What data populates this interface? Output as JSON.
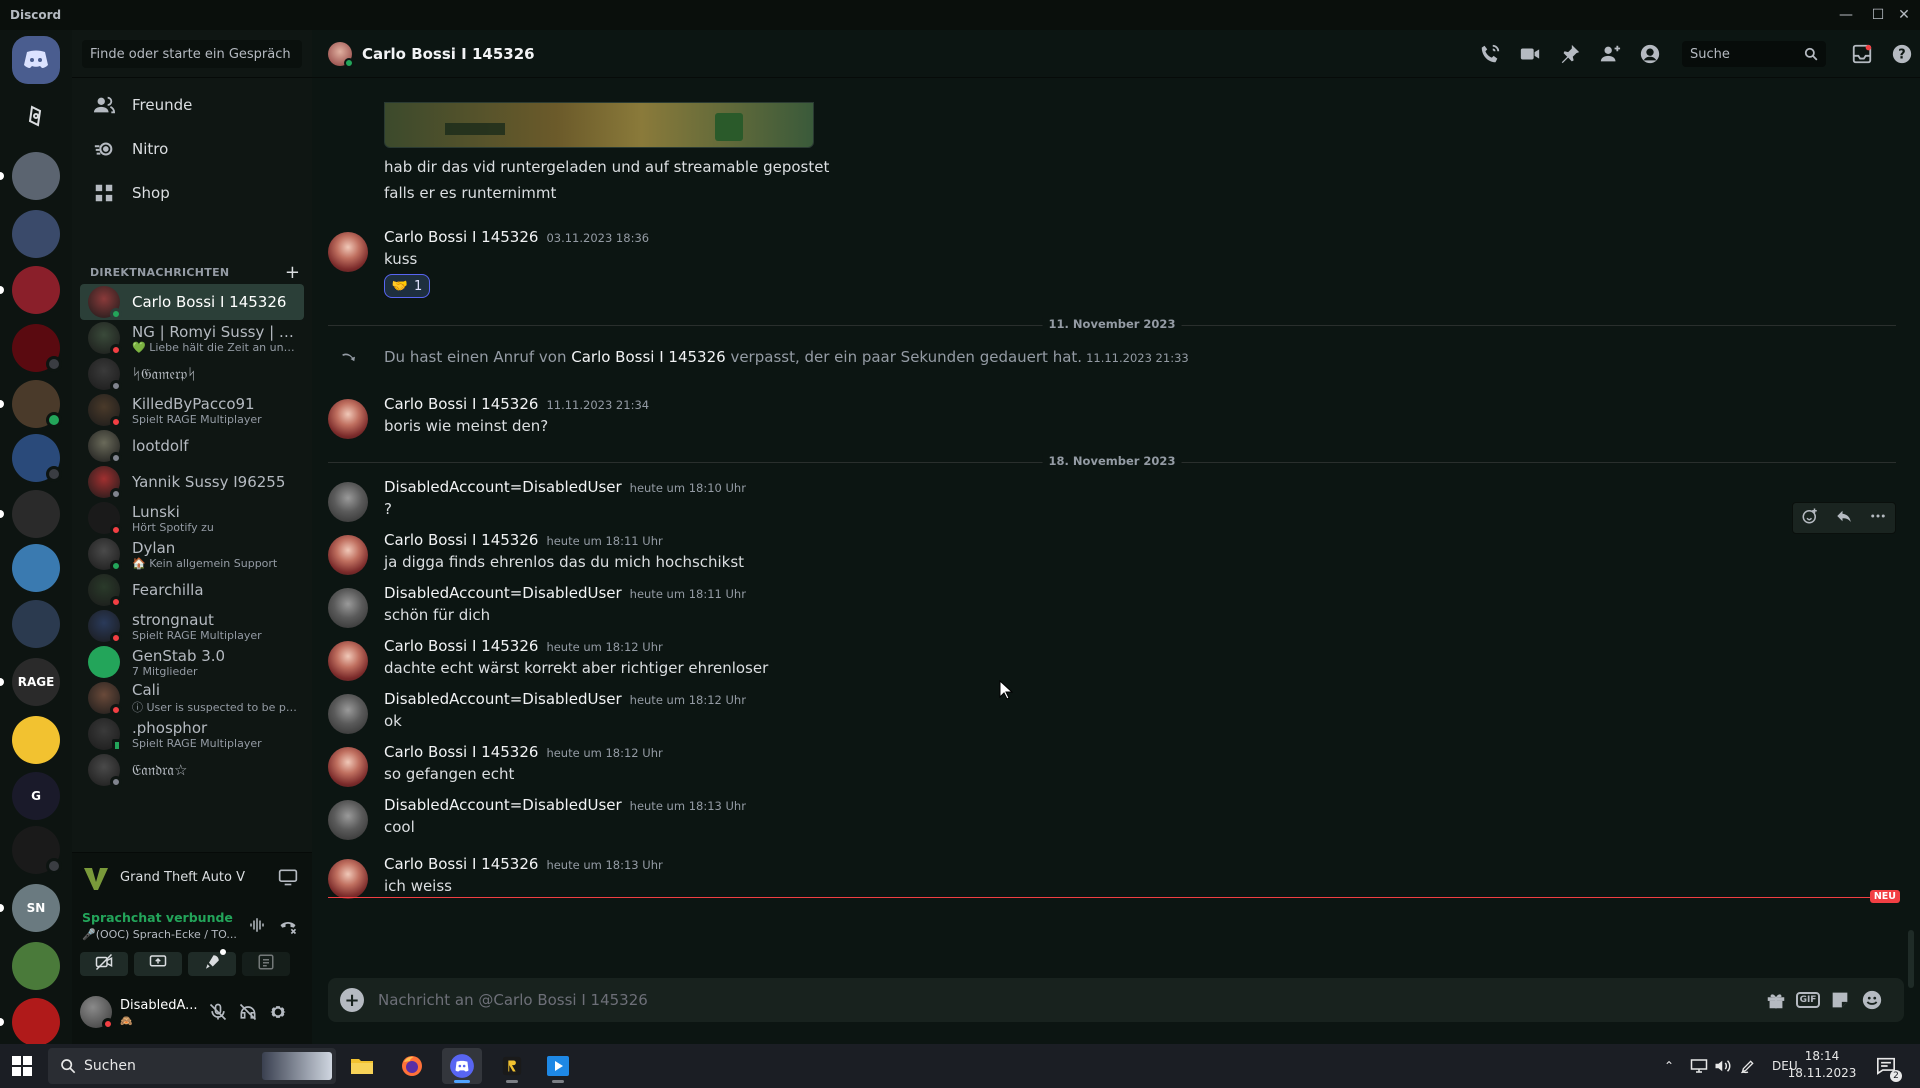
{
  "window": {
    "app_name": "Discord",
    "controls": {
      "minimize": "—",
      "maximize": "☐",
      "close": "✕"
    }
  },
  "servers": [
    {
      "icon": "discord-home-icon",
      "color": "#4a5d8f",
      "label": ""
    },
    {
      "icon": "shortcut-icon",
      "color": "#0d1411",
      "label": ""
    },
    {
      "icon": "server-moon-icon",
      "color": "#5b6470",
      "label": ""
    },
    {
      "icon": "server-crest-icon",
      "color": "#3a4a6a",
      "label": ""
    },
    {
      "icon": "server-red-icon",
      "color": "#8a1f2a",
      "label": ""
    },
    {
      "icon": "server-red-orb-icon",
      "color": "#5a0a10",
      "label": ""
    },
    {
      "icon": "server-group-icon",
      "color": "#4a3a2a",
      "label": ""
    },
    {
      "icon": "server-statue-icon",
      "color": "#2a4a7a",
      "label": ""
    },
    {
      "icon": "server-emblem-icon",
      "color": "#2a2a2a",
      "label": ""
    },
    {
      "icon": "server-sea-icon",
      "color": "#3a7ab0",
      "label": ""
    },
    {
      "icon": "server-folder-icon",
      "color": "#2b3a4f",
      "label": ""
    },
    {
      "icon": "server-rage-icon",
      "color": "#2a2a2a",
      "label": "RAGE"
    },
    {
      "icon": "server-bee-icon",
      "color": "#f2c230",
      "label": ""
    },
    {
      "icon": "server-g-icon",
      "color": "#1a1a2a",
      "label": "G"
    },
    {
      "icon": "server-dark-icon",
      "color": "#1a1a1a",
      "label": ""
    },
    {
      "icon": "server-sn-icon",
      "color": "#6a7a80",
      "label": "SN"
    },
    {
      "icon": "server-frog-icon",
      "color": "#4a7a3a",
      "label": ""
    },
    {
      "icon": "server-ninja-icon",
      "color": "#b01a1a",
      "label": ""
    }
  ],
  "sidebar": {
    "search_placeholder": "Finde oder starte ein Gespräch",
    "nav": [
      {
        "label": "Freunde",
        "icon": "friends-icon"
      },
      {
        "label": "Nitro",
        "icon": "nitro-icon"
      },
      {
        "label": "Shop",
        "icon": "shop-icon"
      }
    ],
    "dm_header": "DIREKTNACHRICHTEN",
    "dm_add": "+",
    "dms": [
      {
        "name": "Carlo Bossi I 145326",
        "sub": "",
        "status": "online",
        "color": "#8a3a3a",
        "active": true
      },
      {
        "name": "NG | Romyi Sussy | 46...",
        "sub": "💚 Liebe hält die Zeit an und l...",
        "status": "dnd",
        "color": "#3a4a3a",
        "active": false
      },
      {
        "name": "ᛋ𝔊𝔞𝔪𝔢𝔯𝔭ᛋ",
        "sub": "",
        "status": "offline",
        "color": "#3a3a3a",
        "active": false
      },
      {
        "name": "KilledByPacco91",
        "sub": "Spielt RAGE Multiplayer",
        "status": "dnd",
        "color": "#4a3a2a",
        "active": false
      },
      {
        "name": "lootdolf",
        "sub": "",
        "status": "offline",
        "color": "#6a6a5a",
        "active": false
      },
      {
        "name": "Yannik Sussy I96255",
        "sub": "",
        "status": "offline",
        "color": "#a03030",
        "active": false
      },
      {
        "name": "Lunski",
        "sub": "Hört Spotify zu",
        "status": "dnd",
        "color": "#1a1a1a",
        "active": false
      },
      {
        "name": "Dylan",
        "sub": "🏠 Kein allgemein Support",
        "status": "online",
        "color": "#4a4a4a",
        "active": false
      },
      {
        "name": "Fearchilla",
        "sub": "",
        "status": "dnd",
        "color": "#2a3a2a",
        "active": false
      },
      {
        "name": "strongnaut",
        "sub": "Spielt RAGE Multiplayer",
        "status": "dnd",
        "color": "#2a3a5a",
        "active": false
      },
      {
        "name": "GenStab 3.0",
        "sub": "7 Mitglieder",
        "status": "none",
        "color": "#23a55a",
        "active": false
      },
      {
        "name": "Cali",
        "sub": "ⓘ User is suspected to be par...",
        "status": "dnd",
        "color": "#6a4a3a",
        "active": false
      },
      {
        "name": ".phosphor",
        "sub": "Spielt RAGE Multiplayer",
        "status": "mobile",
        "color": "#3a3a3a",
        "active": false
      },
      {
        "name": "𝔈𝔞𝔫𝔡𝔯𝔞☆",
        "sub": "",
        "status": "offline",
        "color": "#4a4a4a",
        "active": false
      }
    ],
    "activity": {
      "game": "Grand Theft Auto V"
    },
    "voice": {
      "status": "Sprachchat verbunde",
      "channel": "🎤(OOC) Sprach-Ecke / TO..."
    },
    "user": {
      "name": "DisabledA...",
      "status_emoji": "🙈"
    }
  },
  "chat": {
    "title": "Carlo Bossi I 145326",
    "search_placeholder": "Suche",
    "composer_placeholder": "Nachricht an @Carlo Bossi I 145326",
    "new_badge": "NEU",
    "top_lines": [
      "hab dir das vid runtergeladen und auf streamable gepostet",
      "falls er es runternimmt"
    ],
    "messages_before": [
      {
        "author": "Carlo Bossi I 145326",
        "time": "03.11.2023 18:36",
        "text": "kuss",
        "reaction": {
          "emoji": "🤝",
          "count": "1"
        }
      }
    ],
    "divider_1": "11. November 2023",
    "missed_call": {
      "prefix": "Du hast einen Anruf von",
      "name": "Carlo Bossi I 145326",
      "suffix": "verpasst, der ein paar Sekunden gedauert hat.",
      "time": "11.11.2023 21:33"
    },
    "message_mid": {
      "author": "Carlo Bossi I 145326",
      "time": "11.11.2023 21:34",
      "text": "boris wie meinst den?"
    },
    "divider_2": "18. November 2023",
    "messages": [
      {
        "author": "DisabledAccount=DisabledUser",
        "time": "heute um 18:10 Uhr",
        "text": "?",
        "who": "disabled"
      },
      {
        "author": "Carlo Bossi I 145326",
        "time": "heute um 18:11 Uhr",
        "text": "ja digga finds ehrenlos das du mich hochschikst",
        "who": "carlo"
      },
      {
        "author": "DisabledAccount=DisabledUser",
        "time": "heute um 18:11 Uhr",
        "text": "schön für dich",
        "who": "disabled"
      },
      {
        "author": "Carlo Bossi I 145326",
        "time": "heute um 18:12 Uhr",
        "text": "dachte echt wärst korrekt aber richtiger ehrenloser",
        "who": "carlo"
      },
      {
        "author": "DisabledAccount=DisabledUser",
        "time": "heute um 18:12 Uhr",
        "text": "ok",
        "who": "disabled"
      },
      {
        "author": "Carlo Bossi I 145326",
        "time": "heute um 18:12 Uhr",
        "text": "so gefangen echt",
        "who": "carlo"
      },
      {
        "author": "DisabledAccount=DisabledUser",
        "time": "heute um 18:13 Uhr",
        "text": "cool",
        "who": "disabled"
      },
      {
        "author": "Carlo Bossi I 145326",
        "time": "heute um 18:13 Uhr",
        "text": "ich weiss",
        "who": "carlo"
      }
    ]
  },
  "taskbar": {
    "search_label": "Suchen",
    "language": "DEU",
    "time": "18:14",
    "date": "18.11.2023"
  },
  "colors": {
    "accent_green": "#23a55a",
    "dnd_red": "#f23f43",
    "blurple": "#5865f2"
  }
}
